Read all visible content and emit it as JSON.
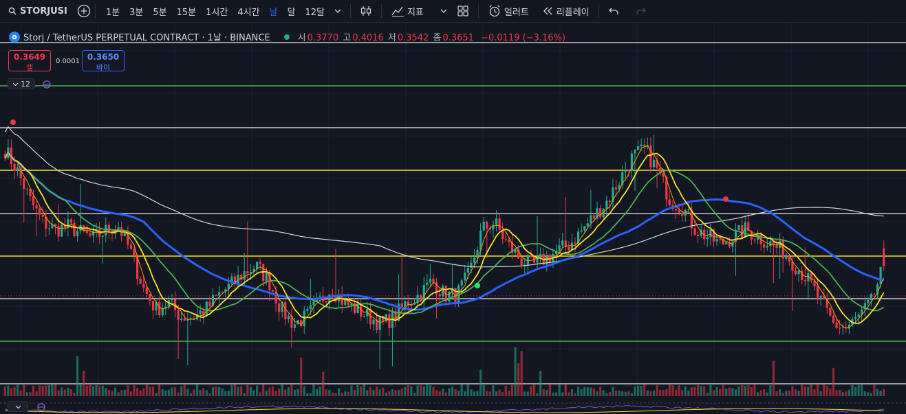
{
  "toolbar": {
    "symbol": "STORJUSI",
    "intervals": [
      "1분",
      "3분",
      "5분",
      "15분",
      "1시간",
      "4시간",
      "날",
      "달",
      "12달"
    ],
    "active_interval": "날",
    "indicators_label": "지표",
    "alert_label": "얼러트",
    "replay_label": "리플레이"
  },
  "legend": {
    "title": "Storj / TetherUS PERPETUAL CONTRACT · 1날 · BINANCE",
    "open_label": "시",
    "open": "0.3770",
    "high_label": "고",
    "high": "0.4016",
    "low_label": "저",
    "low": "0.3542",
    "close_label": "종",
    "close": "0.3651",
    "change": "−0.0119 (−3.16%)"
  },
  "trade": {
    "sell_price": "0.3649",
    "sell_label": "셀",
    "spread": "0.0001",
    "buy_price": "0.3650",
    "buy_label": "바이"
  },
  "indicator_count": "12",
  "colors": {
    "background": "#131722",
    "up": "#22ab94",
    "down": "#f23645",
    "accent": "#2962ff",
    "ma_yellow": "#f7e22d",
    "ma_green": "#4caf50",
    "ma_blue": "#2962ff",
    "ma_white": "#d1d4dc",
    "ma_orange": "#ff9800"
  },
  "chart_data": {
    "type": "candlestick",
    "horizontal_levels": [
      {
        "color": "white",
        "position_label": "top"
      },
      {
        "color": "green"
      },
      {
        "color": "white"
      },
      {
        "color": "yellow"
      },
      {
        "color": "white"
      },
      {
        "color": "yellow"
      },
      {
        "color": "white"
      },
      {
        "color": "green"
      },
      {
        "color": "white"
      }
    ],
    "close_trend": [
      0.445,
      0.43,
      0.41,
      0.395,
      0.39,
      0.392,
      0.388,
      0.384,
      0.389,
      0.393,
      0.375,
      0.35,
      0.335,
      0.34,
      0.33,
      0.33,
      0.335,
      0.345,
      0.352,
      0.36,
      0.365,
      0.355,
      0.335,
      0.325,
      0.33,
      0.34,
      0.35,
      0.34,
      0.335,
      0.33,
      0.325,
      0.33,
      0.34,
      0.345,
      0.355,
      0.345,
      0.345,
      0.36,
      0.39,
      0.395,
      0.38,
      0.37,
      0.365,
      0.37,
      0.375,
      0.38,
      0.39,
      0.4,
      0.41,
      0.425,
      0.44,
      0.445,
      0.43,
      0.41,
      0.405,
      0.39,
      0.385,
      0.38,
      0.385,
      0.39,
      0.385,
      0.38,
      0.375,
      0.365,
      0.355,
      0.34,
      0.325,
      0.322,
      0.33,
      0.34,
      0.3651
    ]
  }
}
